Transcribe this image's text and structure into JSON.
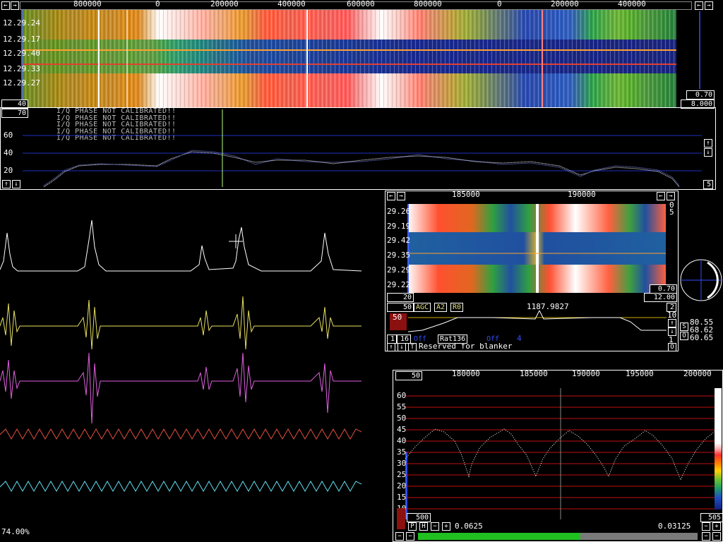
{
  "top_waterfall": {
    "freq_ticks": [
      "800000",
      "0",
      "200000",
      "400000",
      "600000",
      "800000",
      "0",
      "200000",
      "400000"
    ],
    "time_labels": [
      "12.29.24",
      "12.29.17",
      "12.29.40",
      "12.29.33",
      "12.29.27"
    ],
    "box_left": "40",
    "box_right_a": "0.70",
    "box_right_b": "8.000"
  },
  "spectrum": {
    "box_top": "70",
    "warnings": [
      "I/Q PHASE NOT CALIBRATED!!",
      "I/Q PHASE NOT CALIBRATED!!",
      "I/Q PHASE NOT CALIBRATED!!",
      "I/Q PHASE NOT CALIBRATED!!",
      "I/Q PHASE NOT CALIBRATED!!"
    ],
    "y_labels": [
      "60",
      "40",
      "20"
    ],
    "box_right": "5"
  },
  "oscilloscope": {
    "percent": "74.00%"
  },
  "baseband_waterfall": {
    "freq_ticks": [
      "185000",
      "190000"
    ],
    "time_labels": [
      "29.26",
      "29.19",
      "29.42",
      "29.35",
      "29.29",
      "29.22"
    ],
    "box_right_a": "0.70",
    "box_right_b": "12.00",
    "box_left": "20",
    "side_top": "0",
    "side_bottom": "5"
  },
  "baseband_controls": {
    "box_50": "50",
    "agc": "AGC",
    "a2": "A2",
    "r0": "R0",
    "frequency": "1187.9827",
    "box_2": "2",
    "meter_value": "50",
    "box_10": "10",
    "box_1": "1",
    "box_16": "16",
    "off1": "Off",
    "rat": "Rat136",
    "off2": "Off",
    "num_4": "4",
    "t_label": "T",
    "status": "Reserved for blanker",
    "s_label": "S",
    "o_label": "O",
    "read_1": "80.55",
    "read_2": "68.62",
    "read_3": "60.65"
  },
  "hires_spectrum": {
    "box_top": "50",
    "freq_ticks": [
      "180000",
      "185000",
      "190000",
      "195000",
      "200000"
    ],
    "y_labels": [
      "60",
      "55",
      "50",
      "45",
      "40",
      "35",
      "30",
      "25",
      "20",
      "15",
      "10"
    ],
    "box_left": "500",
    "box_right": "505",
    "p_label": "P",
    "h_label": "H",
    "val_left": "0.0625",
    "val_right": "0.03125"
  }
}
